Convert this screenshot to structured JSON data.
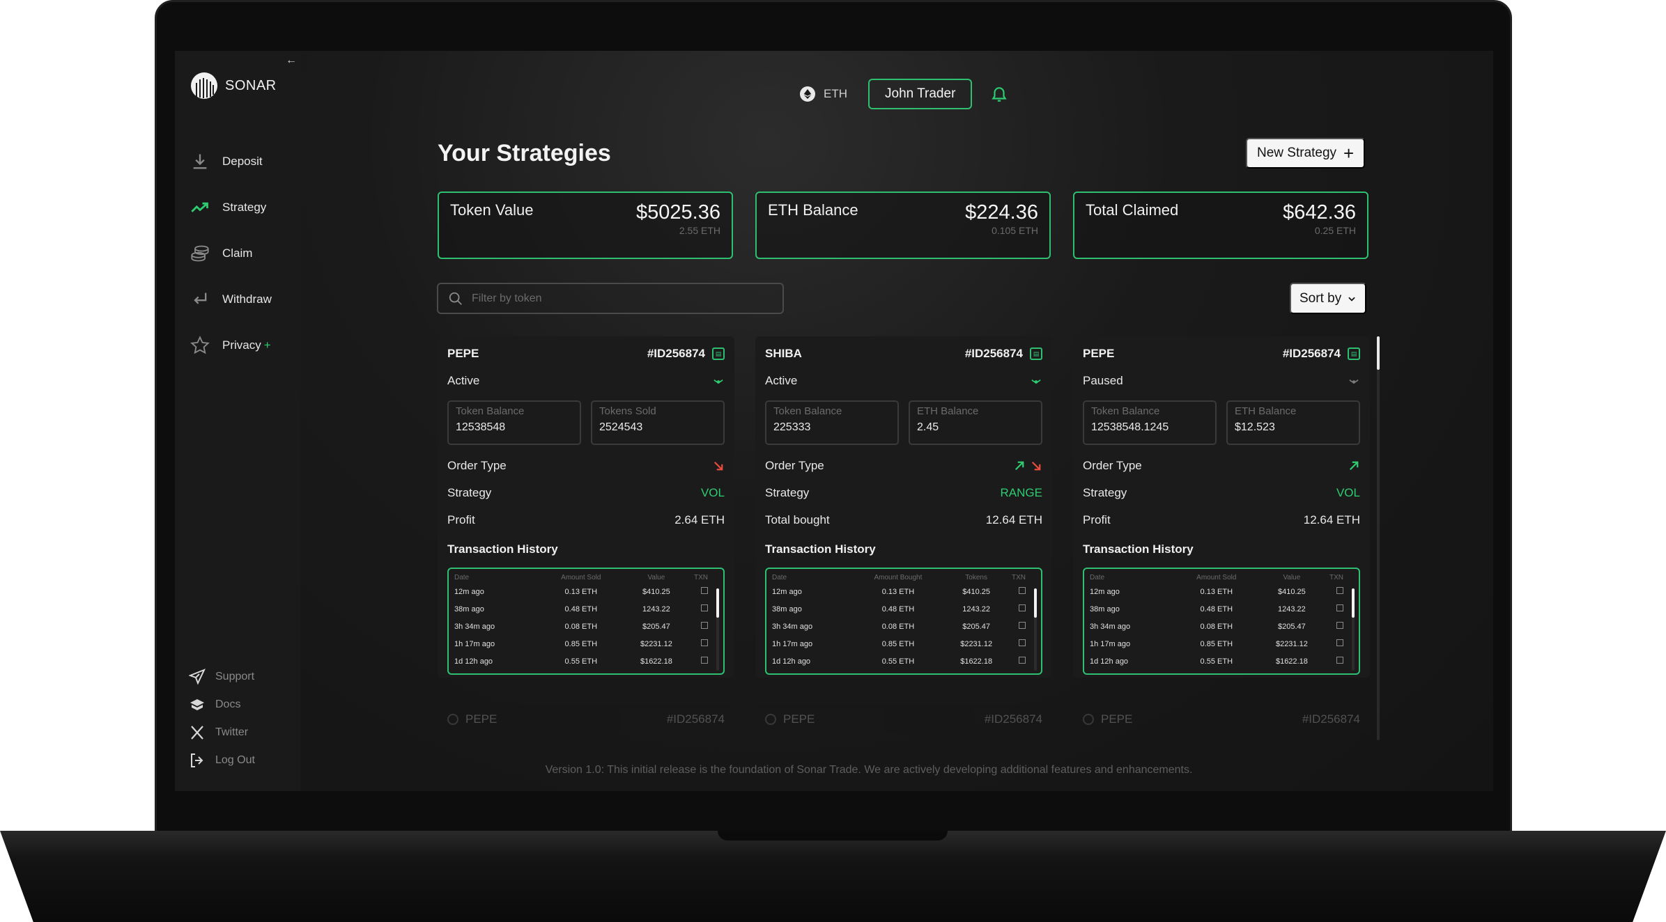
{
  "app": {
    "name": "SONAR"
  },
  "sidebar": {
    "items": [
      {
        "label": "Deposit",
        "icon": "download-icon"
      },
      {
        "label": "Strategy",
        "icon": "trend-up-icon"
      },
      {
        "label": "Claim",
        "icon": "coins-icon"
      },
      {
        "label": "Withdraw",
        "icon": "return-icon"
      },
      {
        "label": "Privacy",
        "icon": "star-icon",
        "badge": "+"
      }
    ],
    "footer": [
      {
        "label": "Support",
        "icon": "send-icon"
      },
      {
        "label": "Docs",
        "icon": "book-icon"
      },
      {
        "label": "Twitter",
        "icon": "x-icon"
      },
      {
        "label": "Log Out",
        "icon": "logout-icon"
      }
    ]
  },
  "header": {
    "network": "ETH",
    "user": "John Trader"
  },
  "main": {
    "title": "Your Strategies",
    "new_strategy": "New Strategy",
    "stats": [
      {
        "label": "Token Value",
        "value": "$5025.36",
        "sub": "2.55 ETH"
      },
      {
        "label": "ETH Balance",
        "value": "$224.36",
        "sub": "0.105 ETH"
      },
      {
        "label": "Total Claimed",
        "value": "$642.36",
        "sub": "0.25 ETH"
      }
    ],
    "filter_placeholder": "Filter by token",
    "sort_label": "Sort by",
    "tx_title": "Transaction History",
    "labels": {
      "order_type": "Order Type",
      "strategy": "Strategy"
    }
  },
  "cards": [
    {
      "token": "PEPE",
      "id": "#ID256874",
      "status": "Active",
      "status_color": "#2ecc71",
      "box1_label": "Token Balance",
      "box1_value": "12538548",
      "box2_label": "Tokens Sold",
      "box2_value": "2524543",
      "order_arrows": [
        "down-red"
      ],
      "strategy": "VOL",
      "metric_label": "Profit",
      "metric_value": "2.64 ETH",
      "tx_headers": [
        "Date",
        "Amount Sold",
        "Value",
        "TXN"
      ],
      "tx_rows": [
        [
          "12m ago",
          "0.13 ETH",
          "$410.25"
        ],
        [
          "38m ago",
          "0.48 ETH",
          "1243.22"
        ],
        [
          "3h 34m ago",
          "0.08 ETH",
          "$205.47"
        ],
        [
          "1h 17m ago",
          "0.85 ETH",
          "$2231.12"
        ],
        [
          "1d 12h ago",
          "0.55 ETH",
          "$1622.18"
        ]
      ]
    },
    {
      "token": "SHIBA",
      "id": "#ID256874",
      "status": "Active",
      "status_color": "#2ecc71",
      "box1_label": "Token Balance",
      "box1_value": "225333",
      "box2_label": "ETH Balance",
      "box2_value": "2.45",
      "order_arrows": [
        "up-green",
        "down-red"
      ],
      "strategy": "RANGE",
      "metric_label": "Total bought",
      "metric_value": "12.64 ETH",
      "tx_headers": [
        "Date",
        "Amount Bought",
        "Tokens",
        "TXN"
      ],
      "tx_rows": [
        [
          "12m ago",
          "0.13 ETH",
          "$410.25"
        ],
        [
          "38m ago",
          "0.48 ETH",
          "1243.22"
        ],
        [
          "3h 34m ago",
          "0.08 ETH",
          "$205.47"
        ],
        [
          "1h 17m ago",
          "0.85 ETH",
          "$2231.12"
        ],
        [
          "1d 12h ago",
          "0.55 ETH",
          "$1622.18"
        ]
      ]
    },
    {
      "token": "PEPE",
      "id": "#ID256874",
      "status": "Paused",
      "status_color": "#7a7a7a",
      "box1_label": "Token Balance",
      "box1_value": "12538548.1245",
      "box2_label": "ETH Balance",
      "box2_value": "$12.523",
      "order_arrows": [
        "up-green"
      ],
      "strategy": "VOL",
      "metric_label": "Profit",
      "metric_value": "12.64 ETH",
      "tx_headers": [
        "Date",
        "Amount Sold",
        "Value",
        "TXN"
      ],
      "tx_rows": [
        [
          "12m ago",
          "0.13 ETH",
          "$410.25"
        ],
        [
          "38m ago",
          "0.48 ETH",
          "1243.22"
        ],
        [
          "3h 34m ago",
          "0.08 ETH",
          "$205.47"
        ],
        [
          "1h 17m ago",
          "0.85 ETH",
          "$2231.12"
        ],
        [
          "1d 12h ago",
          "0.55 ETH",
          "$1622.18"
        ]
      ]
    }
  ],
  "ghost_cards": [
    {
      "token": "PEPE",
      "id": "#ID256874"
    },
    {
      "token": "PEPE",
      "id": "#ID256874"
    },
    {
      "token": "PEPE",
      "id": "#ID256874"
    }
  ],
  "footer": {
    "version": "Version 1.0: This initial release is the foundation of Sonar Trade. We are actively developing additional features and enhancements."
  },
  "colors": {
    "accent": "#2fbf71",
    "negative": "#e74c3c",
    "background": "#141414"
  }
}
